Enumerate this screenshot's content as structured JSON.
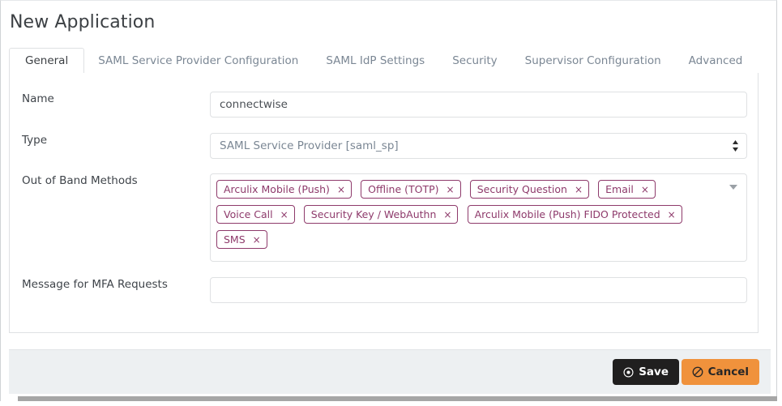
{
  "page": {
    "title": "New Application"
  },
  "tabs": [
    {
      "label": "General",
      "active": true
    },
    {
      "label": "SAML Service Provider Configuration",
      "active": false
    },
    {
      "label": "SAML IdP Settings",
      "active": false
    },
    {
      "label": "Security",
      "active": false
    },
    {
      "label": "Supervisor Configuration",
      "active": false
    },
    {
      "label": "Advanced",
      "active": false
    }
  ],
  "form": {
    "name": {
      "label": "Name",
      "value": "connectwise",
      "placeholder": ""
    },
    "type": {
      "label": "Type",
      "selected": "SAML Service Provider [saml_sp]"
    },
    "oob": {
      "label": "Out of Band Methods",
      "tags": [
        "Arculix Mobile (Push)",
        "Offline (TOTP)",
        "Security Question",
        "Email",
        "Voice Call",
        "Security Key / WebAuthn",
        "Arculix Mobile (Push) FIDO Protected",
        "SMS"
      ],
      "remove_glyph": "×"
    },
    "message": {
      "label": "Message for MFA Requests",
      "value": "",
      "placeholder": ""
    }
  },
  "footer": {
    "save_label": "Save",
    "cancel_label": "Cancel",
    "save_icon": "dot-circle-icon",
    "cancel_icon": "ban-icon"
  },
  "colors": {
    "tag_accent": "#8e3a6b",
    "save_bg": "#201f1f",
    "cancel_bg": "#f0923c",
    "panel_border": "#dfe1e3",
    "footer_bg": "#edf0f2"
  }
}
